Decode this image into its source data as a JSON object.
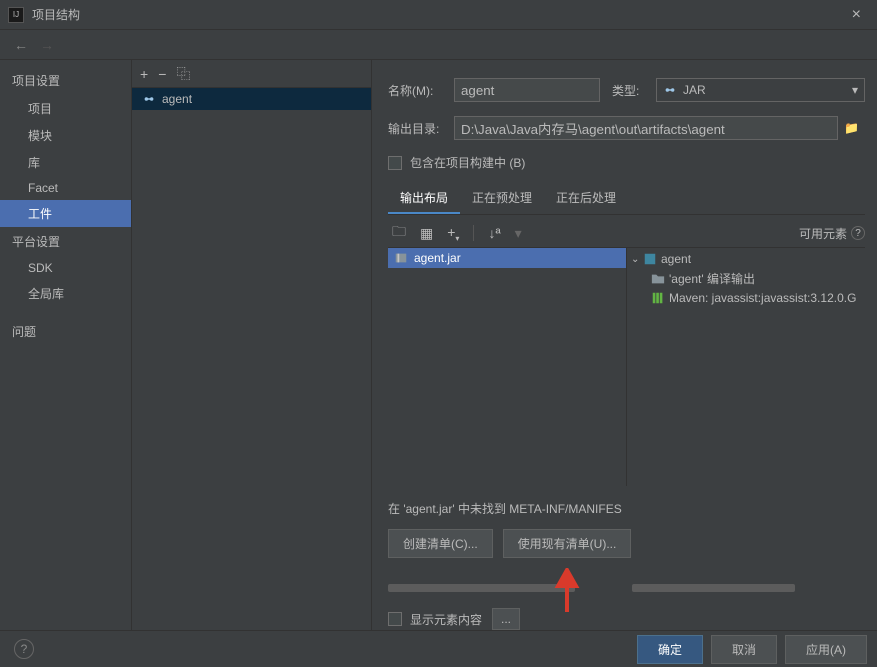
{
  "window": {
    "title": "项目结构"
  },
  "sidebar": {
    "section1": "项目设置",
    "items1": [
      "项目",
      "模块",
      "库",
      "Facet",
      "工件"
    ],
    "section2": "平台设置",
    "items2": [
      "SDK",
      "全局库"
    ],
    "section3": "问题"
  },
  "mid": {
    "item": "agent"
  },
  "right": {
    "name_label": "名称(M):",
    "name_value": "agent",
    "type_label": "类型:",
    "type_value": "JAR",
    "output_label": "输出目录:",
    "output_value": "D:\\Java\\Java内存马\\agent\\out\\artifacts\\agent",
    "include_build": "包含在项目构建中 (B)",
    "tabs": [
      "输出布局",
      "正在预处理",
      "正在后处理"
    ],
    "available": "可用元素",
    "jar_item": "agent.jar",
    "tree_root": "agent",
    "tree_child1": "'agent' 编译输出",
    "tree_child2": "Maven: javassist:javassist:3.12.0.G",
    "manifest_msg": "在 'agent.jar' 中未找到 META-INF/MANIFES",
    "create_manifest": "创建清单(C)...",
    "use_manifest": "使用现有清单(U)...",
    "show_content": "显示元素内容",
    "dots": "..."
  },
  "footer": {
    "ok": "确定",
    "cancel": "取消",
    "apply": "应用(A)"
  }
}
